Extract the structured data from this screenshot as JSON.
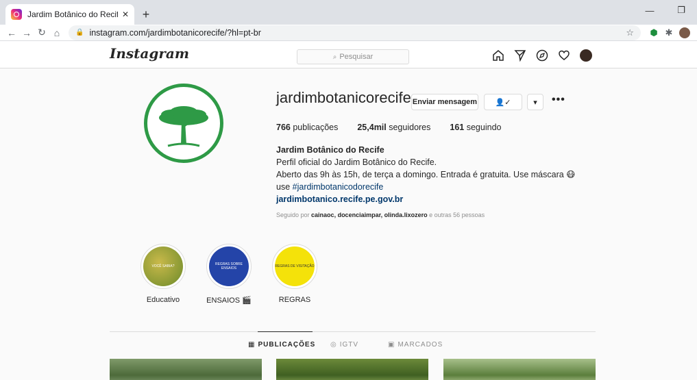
{
  "browser": {
    "tab_title": "Jardim Botânico do Recife (@jard",
    "tab_close": "✕",
    "new_tab": "+",
    "url": "instagram.com/jardimbotanicorecife/?hl=pt-br",
    "win_minimize": "—",
    "win_restore": "❐"
  },
  "header": {
    "logo": "Instagram",
    "search_placeholder": "Pesquisar"
  },
  "profile": {
    "username": "jardimbotanicorecife",
    "message_button": "Enviar mensagem",
    "follow_icon_label": "👤✓",
    "dropdown_label": "▾",
    "more_label": "•••",
    "stats": {
      "posts_count": "766",
      "posts_label": "publicações",
      "followers_count": "25,4mil",
      "followers_label": "seguidores",
      "following_count": "161",
      "following_label": "seguindo"
    },
    "bio": {
      "name": "Jardim Botânico do Recife",
      "line1": "Perfil oficial do Jardim Botânico do Recife.",
      "line2": "Aberto das 9h às 15h, de terça a domingo. Entrada é gratuita. Use máscara 😷",
      "line3_prefix": "use ",
      "hashtag": "#jardimbotanicodorecife",
      "website": "jardimbotanico.recife.pe.gov.br"
    },
    "followed_by_prefix": "Seguido por ",
    "followed_by_names": "cainaoc, docenciaimpar, olinda.lixozero",
    "followed_by_suffix": " e outras 56 pessoas"
  },
  "highlights": [
    {
      "label": "Educativo",
      "color": "#a9b23a",
      "inner_text": "VOCÊ SABIA?"
    },
    {
      "label": "ENSAIOS 🎬",
      "color": "#2444a8",
      "inner_text": "REGRAS SOBRE ENSAIOS"
    },
    {
      "label": "REGRAS",
      "color": "#f4e20a",
      "inner_text": "REGRAS DE VISITAÇÃO"
    }
  ],
  "post_tabs": {
    "posts": "PUBLICAÇÕES",
    "igtv": "IGTV",
    "tagged": "MARCADOS"
  },
  "colors": {
    "brand_green": "#2e9a46",
    "link_blue": "#00376b"
  }
}
